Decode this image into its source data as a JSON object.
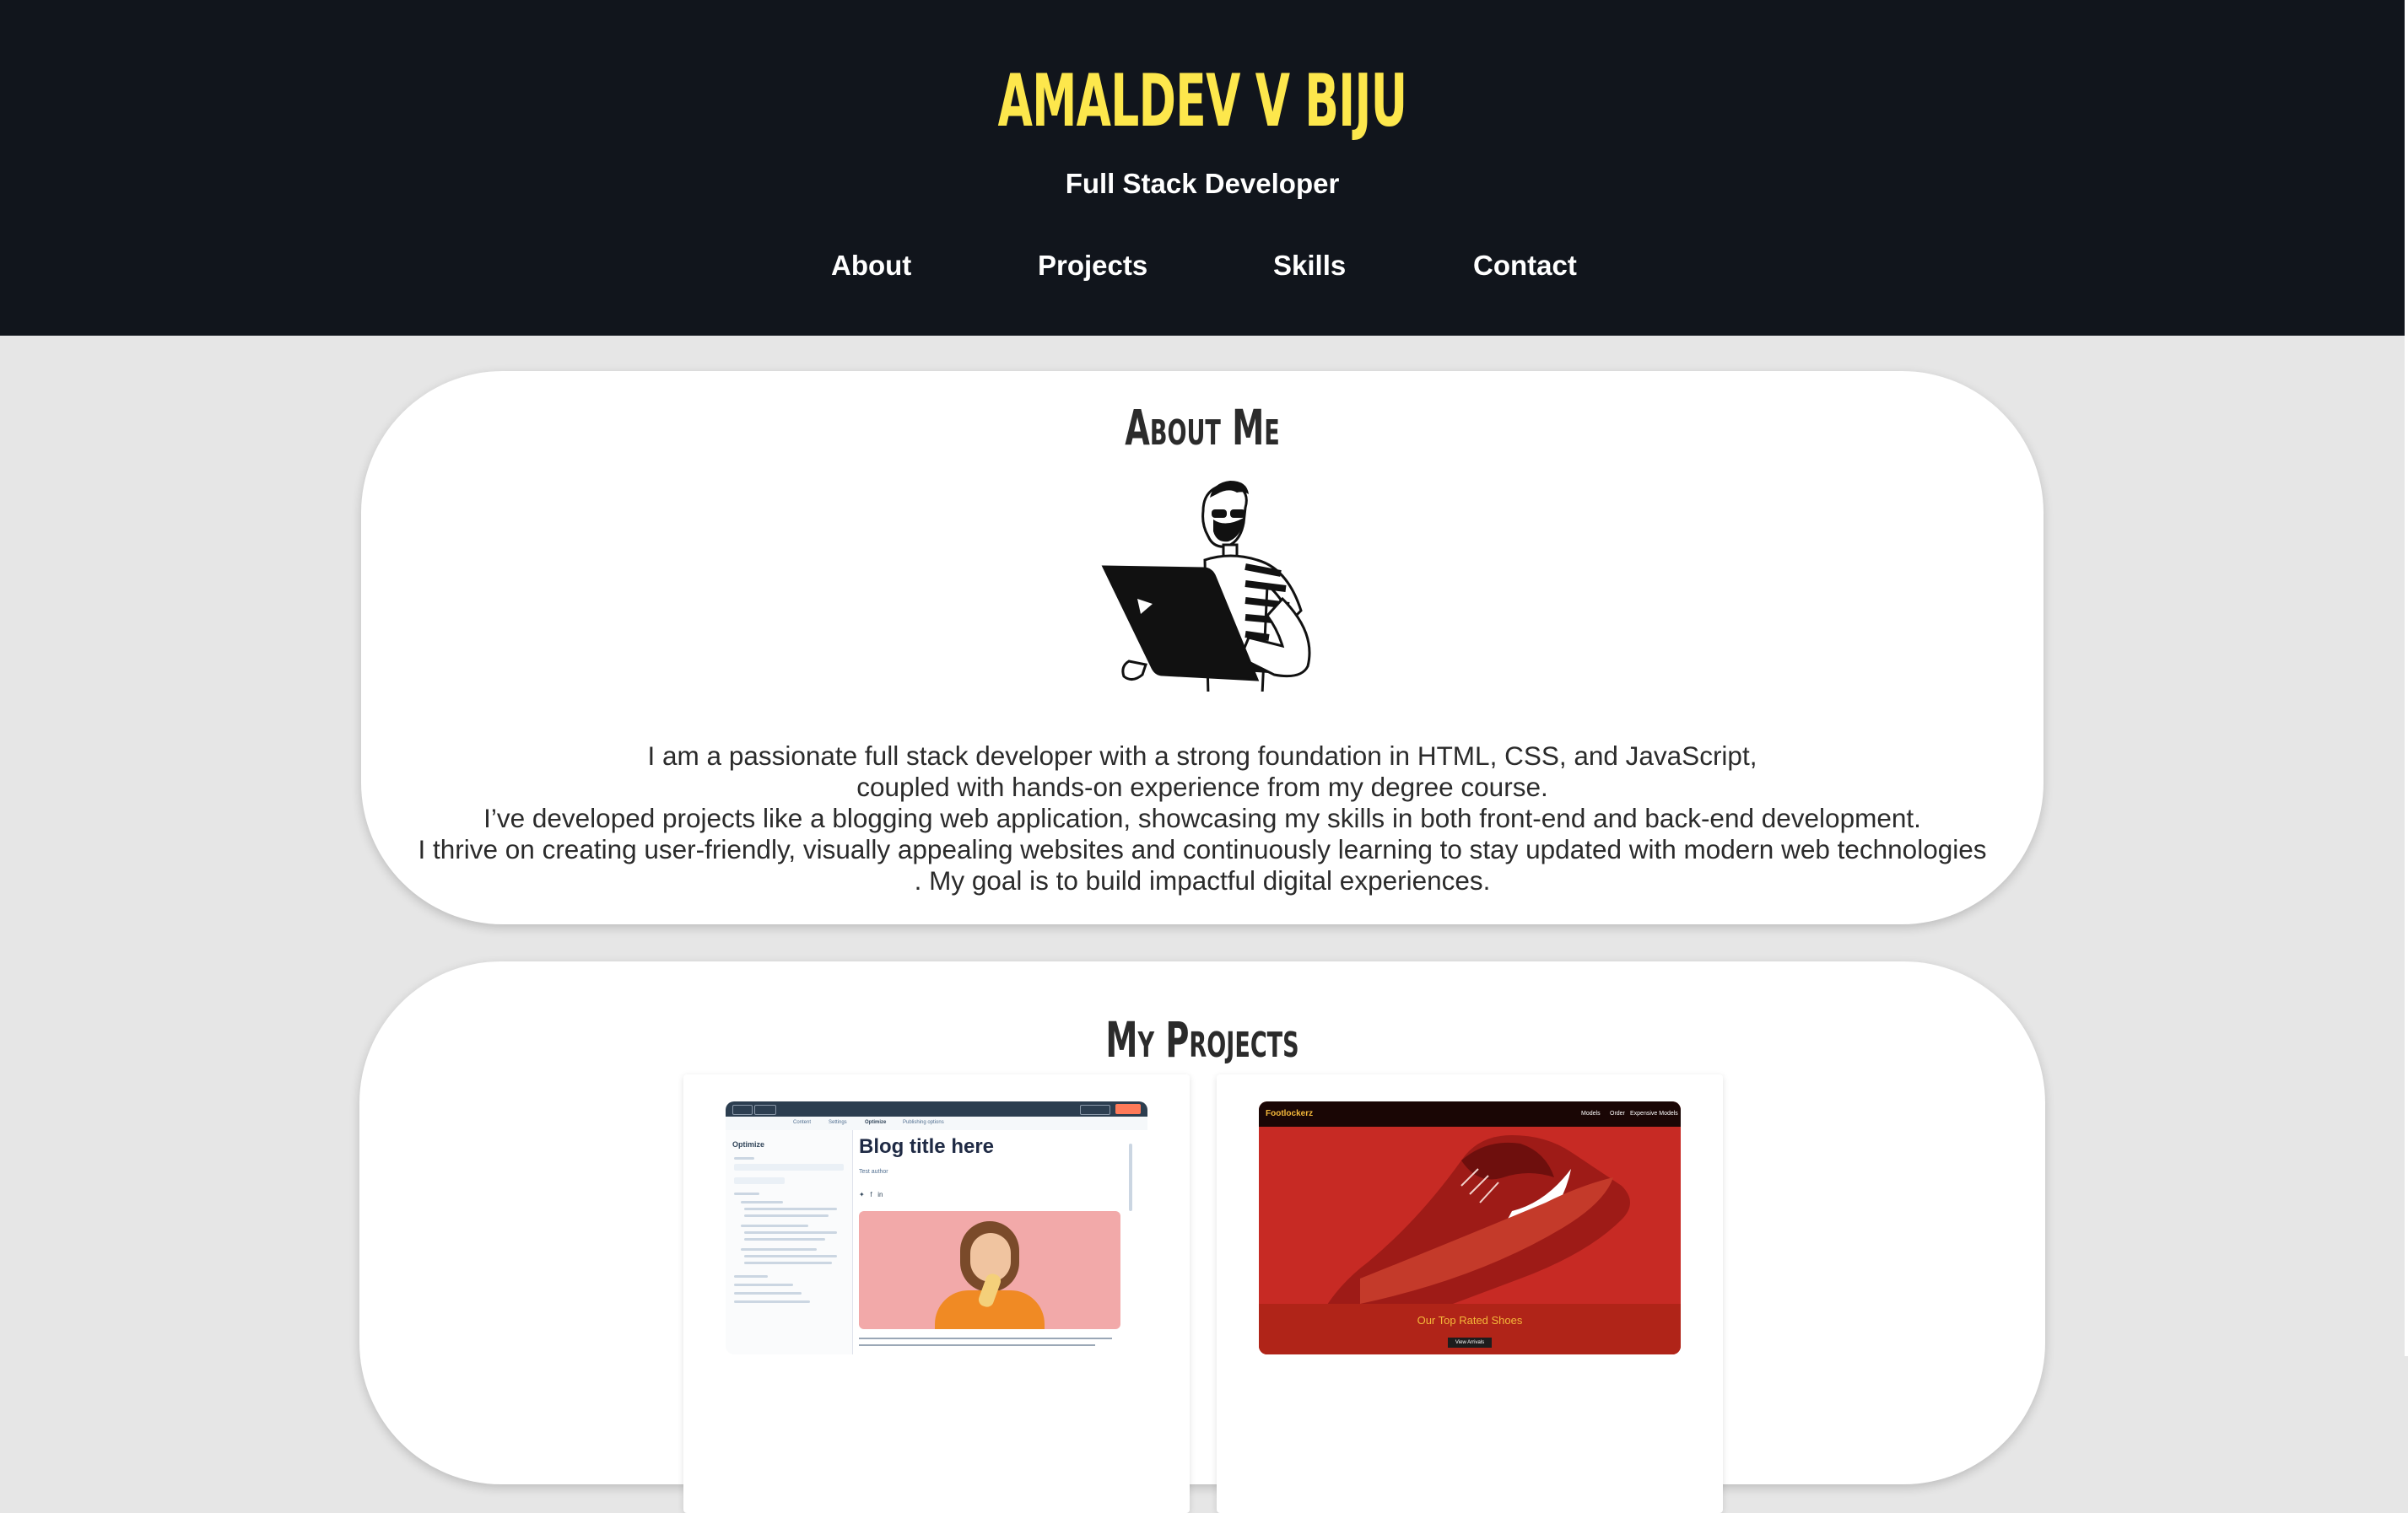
{
  "header": {
    "name": "AMALDEV V BIJU",
    "role": "Full Stack Developer",
    "nav": [
      {
        "label": "About"
      },
      {
        "label": "Projects"
      },
      {
        "label": "Skills"
      },
      {
        "label": "Contact"
      }
    ]
  },
  "about": {
    "title": "About Me",
    "lines": [
      "I am a passionate full stack developer with a strong foundation in HTML, CSS, and JavaScript,",
      "coupled with hands-on experience from my degree course.",
      "I’ve developed projects like a blogging web application, showcasing my skills in both front-end and back-end development.",
      "I thrive on creating user-friendly, visually appealing websites and continuously learning to stay updated with modern web technologies",
      ". My goal is to build impactful digital experiences."
    ]
  },
  "projects": {
    "title": "My Projects",
    "blog": {
      "heading": "Blog title here",
      "author": "Test author",
      "sidebar_title": "Optimize",
      "tabs": [
        "Content",
        "Settings",
        "Optimize",
        "Publishing options"
      ]
    },
    "shop": {
      "brand": "Footlockerz",
      "links": [
        "Models",
        "Order",
        "Expensive Models"
      ],
      "caption": "Our Top Rated Shoes",
      "button": "View Arrivals"
    }
  },
  "colors": {
    "header_bg": "#11151c",
    "accent": "#fde74c",
    "page_bg": "#e6e6e6"
  }
}
